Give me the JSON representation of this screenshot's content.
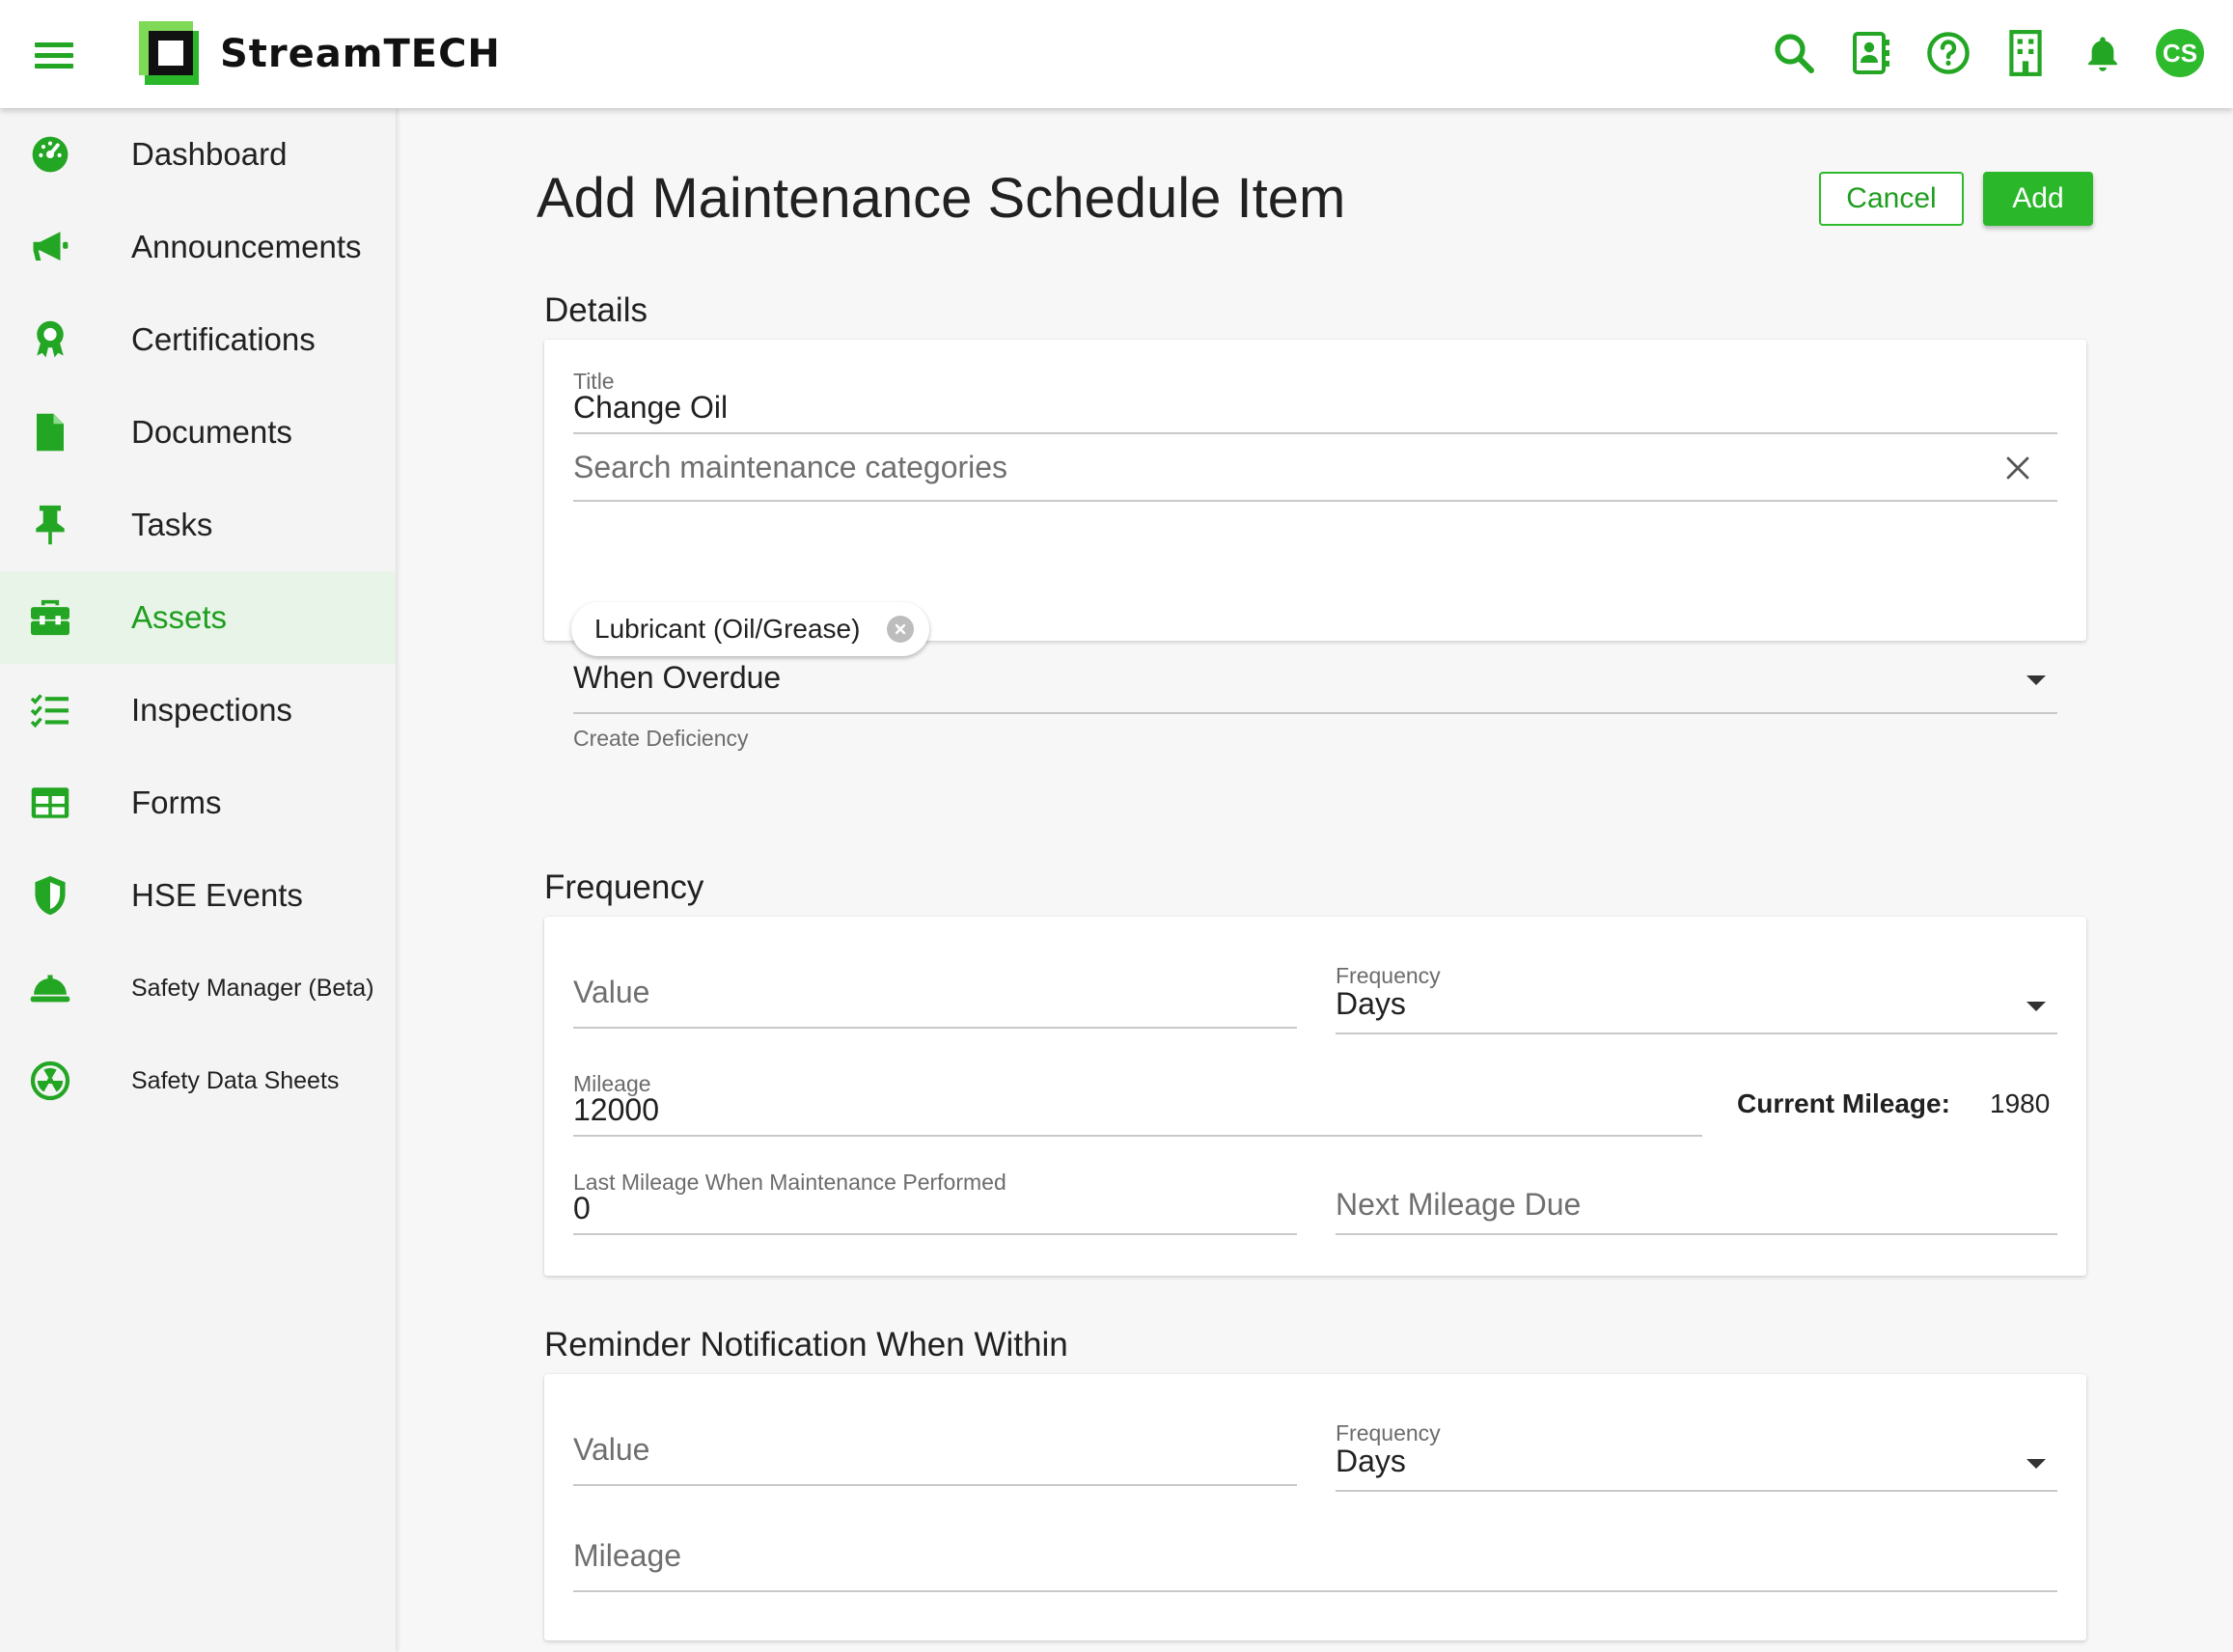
{
  "app": {
    "logo_text": "StreamTECH",
    "accent_color": "#2ab82a"
  },
  "topbar": {
    "icons": [
      "search-icon",
      "contact-card-icon",
      "help-icon",
      "building-icon",
      "bell-icon"
    ],
    "avatar_initials": "CS"
  },
  "sidebar": {
    "items": [
      {
        "label": "Dashboard",
        "icon": "dashboard-icon"
      },
      {
        "label": "Announcements",
        "icon": "megaphone-icon"
      },
      {
        "label": "Certifications",
        "icon": "award-icon"
      },
      {
        "label": "Documents",
        "icon": "document-icon"
      },
      {
        "label": "Tasks",
        "icon": "pin-icon"
      },
      {
        "label": "Assets",
        "icon": "toolbox-icon",
        "active": true
      },
      {
        "label": "Inspections",
        "icon": "checklist-icon"
      },
      {
        "label": "Forms",
        "icon": "table-icon"
      },
      {
        "label": "HSE Events",
        "icon": "shield-icon"
      },
      {
        "label": "Safety Manager (Beta)",
        "icon": "hardhat-icon"
      },
      {
        "label": "Safety Data Sheets",
        "icon": "radiation-icon"
      }
    ]
  },
  "page": {
    "title": "Add Maintenance Schedule Item",
    "cancel_label": "Cancel",
    "add_label": "Add"
  },
  "details": {
    "section_title": "Details",
    "title_label": "Title",
    "title_value": "Change Oil",
    "category_search_placeholder": "Search maintenance categories",
    "selected_category": "Lubricant (Oil/Grease)",
    "overdue_select_value": "When Overdue",
    "overdue_select_label": "Create Deficiency"
  },
  "frequency": {
    "section_title": "Frequency",
    "value_placeholder": "Value",
    "frequency_label": "Frequency",
    "frequency_value": "Days",
    "mileage_label": "Mileage",
    "mileage_value": "12000",
    "current_mileage_label": "Current Mileage:",
    "current_mileage_value": "1980",
    "last_mileage_label": "Last Mileage When Maintenance Performed",
    "last_mileage_value": "0",
    "next_mileage_placeholder": "Next Mileage Due"
  },
  "reminder": {
    "section_title": "Reminder Notification When Within",
    "value_placeholder": "Value",
    "frequency_label": "Frequency",
    "frequency_value": "Days",
    "mileage_placeholder": "Mileage"
  }
}
